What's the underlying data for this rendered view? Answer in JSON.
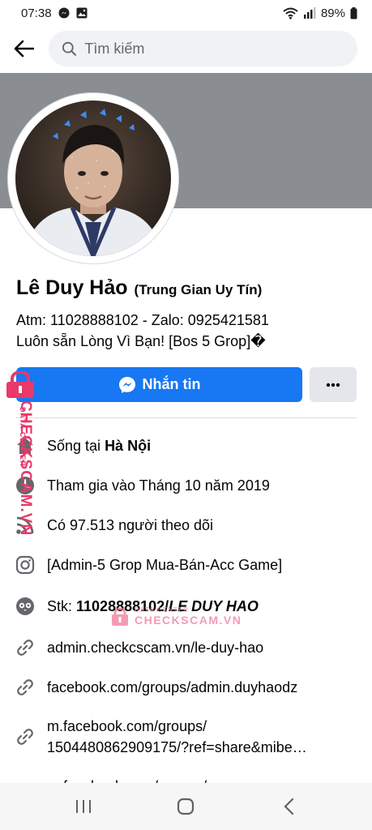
{
  "status_bar": {
    "time": "07:38",
    "battery": "89%"
  },
  "search": {
    "placeholder": "Tìm kiếm"
  },
  "profile": {
    "name": "Lê Duy Hảo",
    "name_suffix": "(Trung Gian Uy Tín)",
    "bio_line1": "Atm: 11028888102 - Zalo: 0925421581",
    "bio_line2": " Luôn sẵn Lòng Vì Bạn! [Bos 5 Grop]�"
  },
  "actions": {
    "message_label": "Nhắn tin"
  },
  "details": {
    "lives_prefix": "Sống tại ",
    "lives_city": "Hà Nội",
    "joined": "Tham gia vào Tháng 10 năm 2019",
    "followers": "Có 97.513 người theo dõi",
    "instagram": "[Admin-5 Grop Mua-Bán-Acc Game]",
    "stk_prefix": "Stk: ",
    "stk_number": "11028888102/",
    "stk_name": "LE DUY HAO",
    "link1": "admin.checkcscam.vn/le-duy-hao",
    "link2": "facebook.com/groups/admin.duyhaodz",
    "link3_line1": "m.facebook.com/groups/",
    "link3_line2": "1504480862909175/?ref=share&mibe…",
    "link4_partial": "m.facebook.com/groups/"
  },
  "watermark": {
    "side_text": "CHECKSCAM.VN",
    "side_small": "DATA CENTER",
    "center_small": "DATA CENTER",
    "center_text": "CHECKSCAM.VN"
  },
  "colors": {
    "accent": "#1877f2",
    "cover": "#8a8d91",
    "watermark": "#e8396a"
  }
}
